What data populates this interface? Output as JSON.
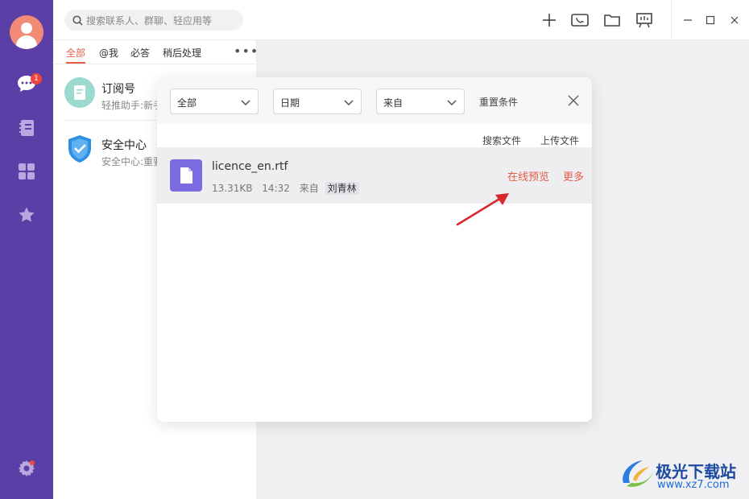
{
  "search": {
    "placeholder": "搜索联系人、群聊、轻应用等"
  },
  "rail": {
    "unread_badge": "1"
  },
  "tabs": [
    "全部",
    "@我",
    "必答",
    "稍后处理"
  ],
  "conversations": [
    {
      "name": "订阅号",
      "preview": "轻推助手:新手"
    },
    {
      "name": "安全中心",
      "preview": "安全中心:重要"
    }
  ],
  "dialog": {
    "filters": {
      "type": "全部",
      "date": "日期",
      "from": "来自"
    },
    "reset_label": "重置条件",
    "search_files": "搜索文件",
    "upload_files": "上传文件",
    "file": {
      "name": "licence_en.rtf",
      "size": "13.31KB",
      "time": "14:32",
      "from_label": "来自",
      "sender": "刘青林",
      "preview_link": "在线预览",
      "more_link": "更多"
    }
  },
  "watermark": {
    "name": "极光下载站",
    "url": "www.xz7.com"
  },
  "colors": {
    "rail": "#5b3fa6",
    "accent": "#e45d4a",
    "file_icon": "#7a6be0"
  }
}
